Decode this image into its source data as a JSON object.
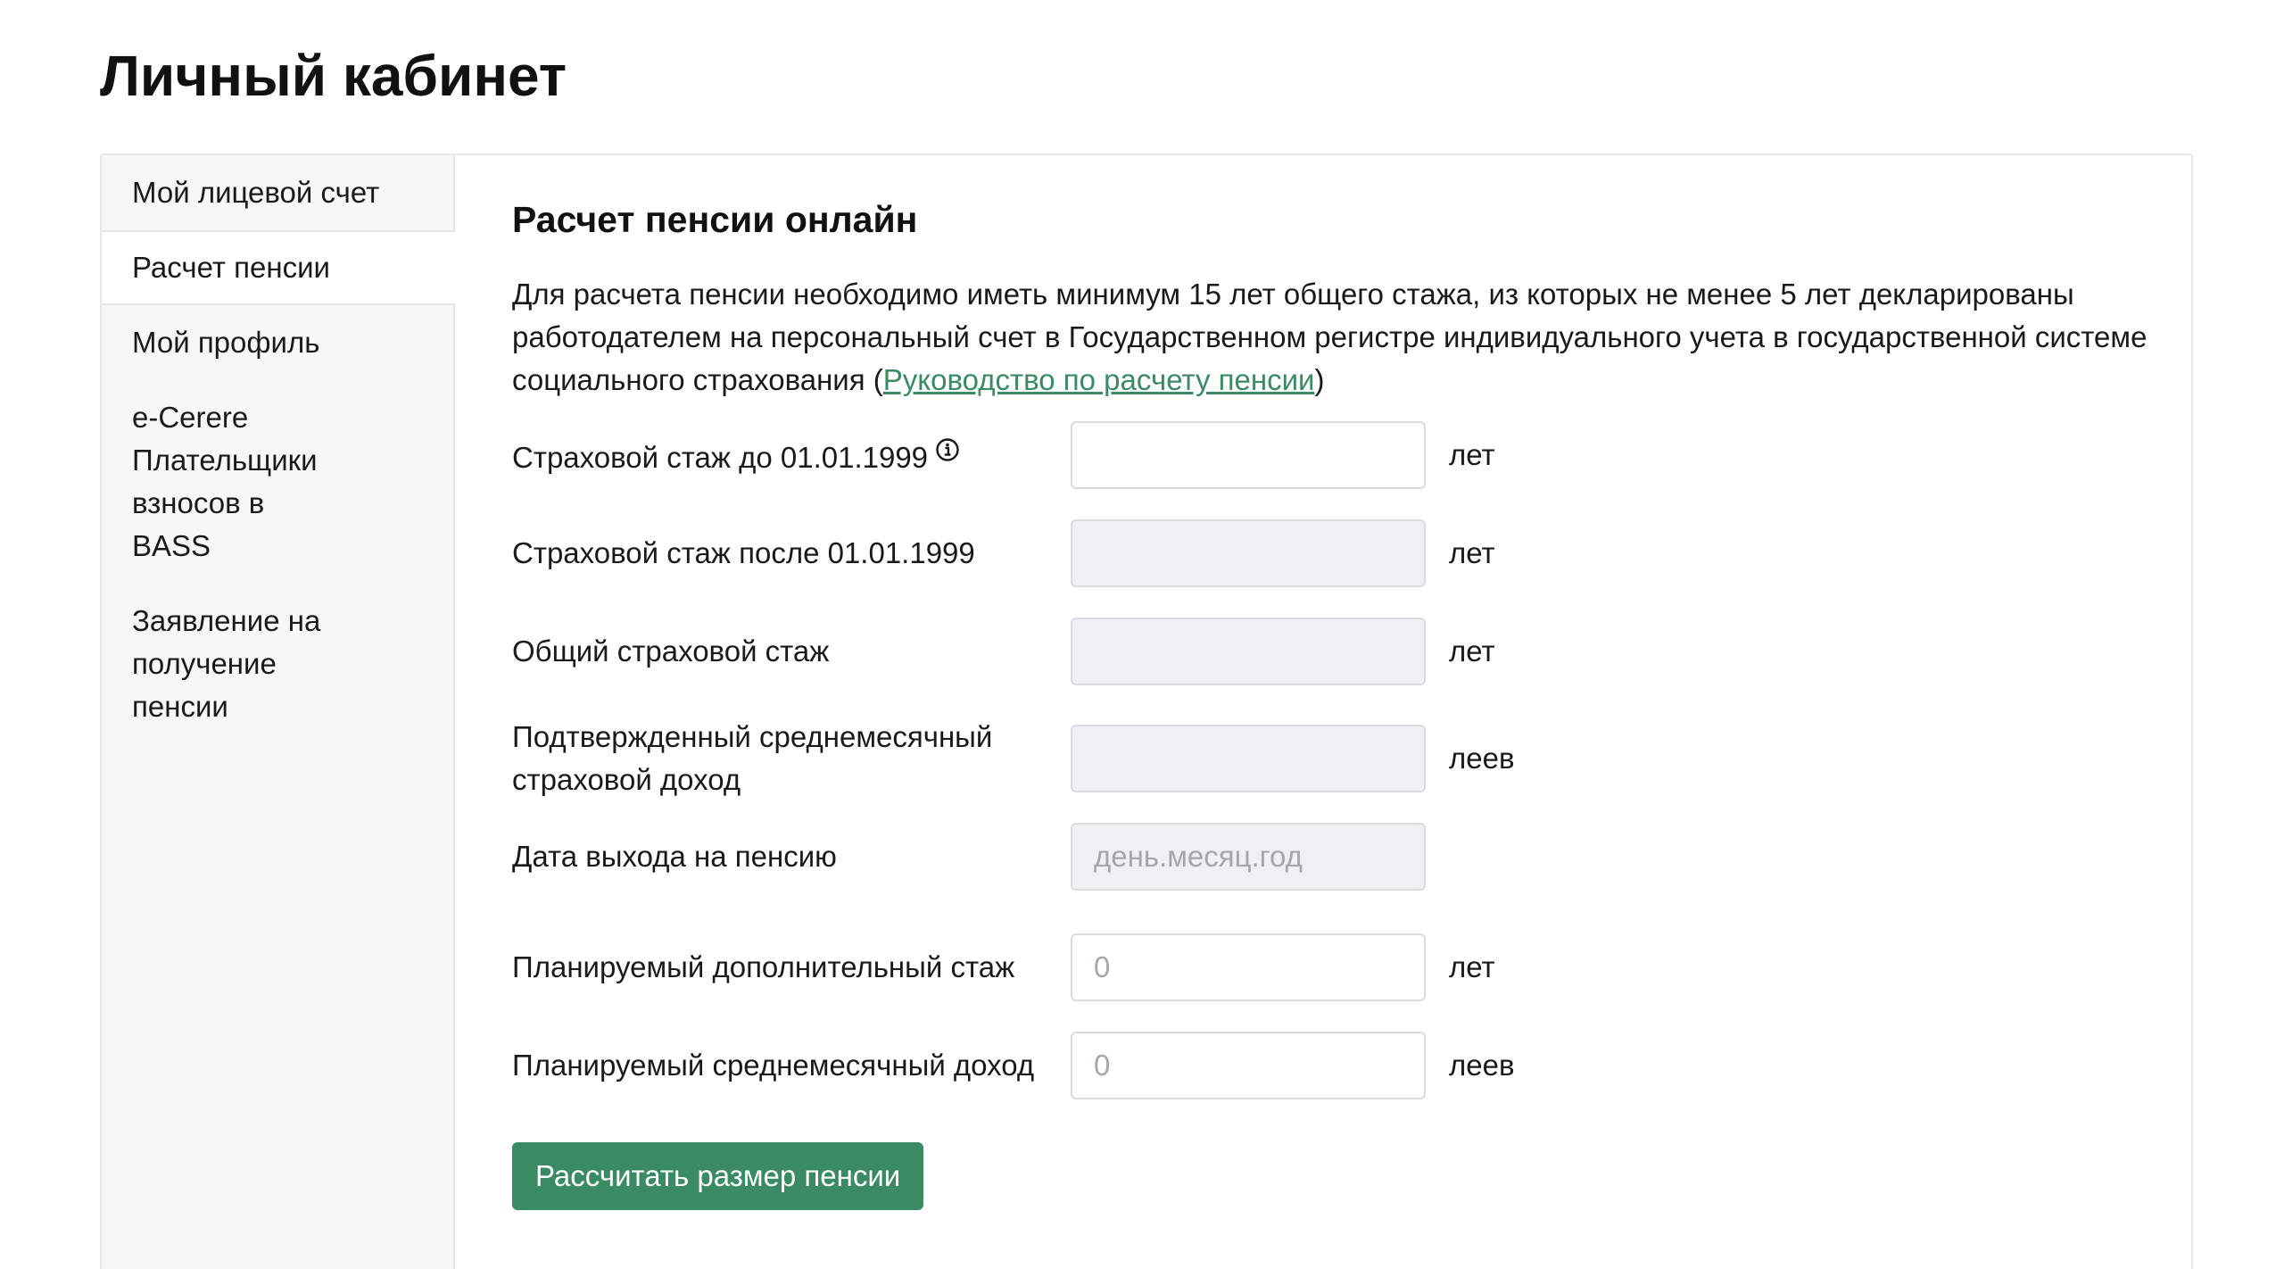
{
  "page": {
    "title": "Личный кабинет"
  },
  "sidebar": {
    "items": [
      {
        "label": "Мой лицевой счет"
      },
      {
        "label": "Расчет пенсии"
      },
      {
        "label": "Мой профиль"
      },
      {
        "label": "e-Cerere Плательщики взносов в BASS"
      },
      {
        "label": "Заявление на получение пенсии"
      }
    ],
    "active": "Расчет пенсии"
  },
  "main": {
    "title": "Расчет пенсии онлайн",
    "intro_text": "Для расчета пенсии необходимо иметь минимум 15 лет общего стажа, из которых не менее 5 лет декларированы работодателем на персональный счет в Государственном регистре индивидуального учета в государственной системе социального страхования (",
    "intro_link": "Руководство по расчету пенсии",
    "intro_close": ")"
  },
  "form": {
    "fields": [
      {
        "label": "Страховой стаж до 01.01.1999",
        "value": "",
        "placeholder": "",
        "unit": "лет",
        "readonly": false,
        "info_icon": true
      },
      {
        "label": "Страховой стаж после 01.01.1999",
        "value": "",
        "placeholder": "",
        "unit": "лет",
        "readonly": true
      },
      {
        "label": "Общий страховой стаж",
        "value": "",
        "placeholder": "",
        "unit": "лет",
        "readonly": true
      },
      {
        "label": "Подтвержденный среднемесячный страховой доход",
        "value": "",
        "placeholder": "",
        "unit": "леев",
        "readonly": true
      },
      {
        "label": "Дата выхода на пенсию",
        "value": "",
        "placeholder": "день.месяц.год",
        "unit": "",
        "readonly": true
      },
      {
        "label": "Планируемый дополнительный стаж",
        "value": "",
        "placeholder": "0",
        "unit": "лет",
        "readonly": false
      },
      {
        "label": "Планируемый среднемесячный доход",
        "value": "",
        "placeholder": "0",
        "unit": "леев",
        "readonly": false
      }
    ],
    "submit_label": "Рассчитать размер пенсии"
  },
  "colors": {
    "accent": "#3a8a63",
    "sidebar_bg": "#f6f7f8",
    "readonly_field_bg": "#eef0f3",
    "border": "#e4e6e9"
  },
  "icons": {
    "info": "info-icon"
  }
}
